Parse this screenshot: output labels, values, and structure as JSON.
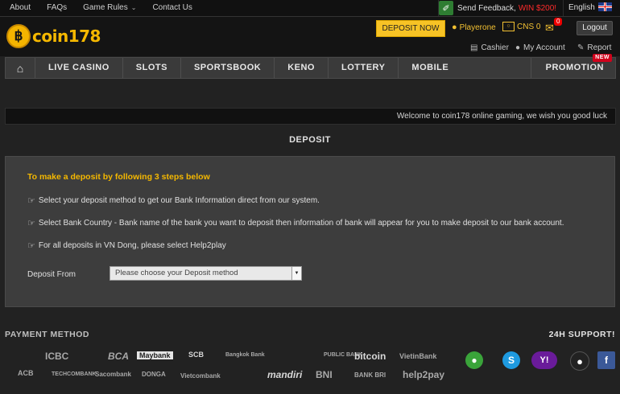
{
  "topbar": {
    "links": [
      "About",
      "FAQs",
      "Game Rules",
      "Contact Us"
    ],
    "feedback_label": "Send Feedback,",
    "feedback_prize": "WIN $200!",
    "language": "English"
  },
  "header": {
    "logo_text": "coin178",
    "deposit_button": "DEPOSIT NOW",
    "username": "Playerone",
    "balance": "CNS 0",
    "mail_badge": "0",
    "logout": "Logout",
    "links": [
      "Cashier",
      "My Account",
      "Report"
    ]
  },
  "nav": {
    "items": [
      "LIVE CASINO",
      "SLOTS",
      "SPORTSBOOK",
      "KENO",
      "LOTTERY",
      "MOBILE"
    ],
    "promotion": "PROMOTION",
    "new_tag": "NEW"
  },
  "marquee": "Welcome to coin178 online gaming, we wish you good luck",
  "page": {
    "title": "DEPOSIT",
    "heading": "To make a deposit by following 3 steps below",
    "steps": [
      "Select your deposit method to get our Bank Information direct from our system.",
      "Select Bank Country - Bank name of the bank you want to deposit then information of bank will appear for you to make deposit to our bank account.",
      "For all deposits in VN Dong, please select Help2play"
    ],
    "deposit_from_label": "Deposit From",
    "deposit_select_value": "Please choose your Deposit method"
  },
  "footer": {
    "payment_title": "PAYMENT METHOD",
    "support_title": "24H SUPPORT!",
    "banks": [
      "ICBC",
      "BCA",
      "Maybank",
      "SCB",
      "Bangkok Bank",
      "PUBLIC BANK",
      "bitcoin",
      "VietinBank",
      "ACB",
      "TECHCOMBANK",
      "Sacombank",
      "DONGA",
      "Vietcombank",
      "mandiri",
      "BNI",
      "BANK BRI",
      "help2pay"
    ],
    "support_icons": [
      "wechat-icon",
      "skype-icon",
      "yahoo-icon",
      "qq-icon",
      "facebook-icon"
    ]
  },
  "colors": {
    "accent": "#f5b800",
    "deposit_button": "#f7c325",
    "feedback_prize": "#ff2b2b",
    "new_tag": "#d0021b"
  }
}
